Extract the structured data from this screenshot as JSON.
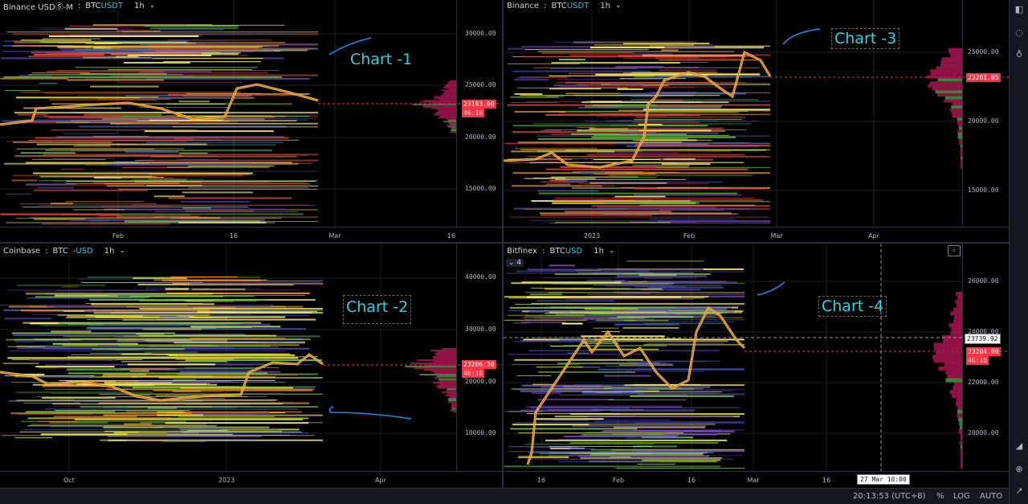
{
  "charts": [
    {
      "id": "tl",
      "exchange": "Binance USDⓈ-M",
      "pair_base": "BTC",
      "pair_quote": "USDT",
      "interval": "1h",
      "price_ticks": [
        "30000.00",
        "25000.00",
        "20000.00",
        "15000.00"
      ],
      "time_labels": [
        "Feb",
        "16",
        "Mar",
        "16"
      ],
      "last_price": "23193.00",
      "countdown": "46:18",
      "annotation": "Chart -1"
    },
    {
      "id": "tr",
      "exchange": "Binance",
      "pair_base": "BTC",
      "pair_quote": "USDT",
      "interval": "1h",
      "price_ticks": [
        "25000.00",
        "20000.00",
        "15000.00"
      ],
      "time_labels": [
        "2023",
        "Feb",
        "Mar",
        "Apr"
      ],
      "last_price": "23201.05",
      "annotation": "Chart -3"
    },
    {
      "id": "bl",
      "exchange": "Coinbase",
      "pair_base": "BTC",
      "pair_quote": "USD",
      "interval": "1h",
      "price_ticks": [
        "40000.00",
        "30000.00",
        "20000.00",
        "10000.00"
      ],
      "time_labels": [
        "Oct",
        "2023",
        "Apr"
      ],
      "last_price": "23206.30",
      "countdown": "46:18",
      "annotation": "Chart -2"
    },
    {
      "id": "br",
      "exchange": "Bitfinex",
      "pair_base": "BTC",
      "pair_quote": "USD",
      "interval": "1h",
      "collapsed_count": "4",
      "price_ticks": [
        "26000.00",
        "24000.00",
        "22000.00",
        "20000.00"
      ],
      "time_labels": [
        "16",
        "Feb",
        "16",
        "Mar",
        "16"
      ],
      "crosshair_price": "23739.92",
      "last_price": "23204.00",
      "countdown": "46:18",
      "crosshair_time": "27 Mar 10:00",
      "annotation": "Chart -4"
    }
  ],
  "bottom_bar": {
    "clock": "20:13:53 (UTC+8)",
    "percent": "%",
    "log": "LOG",
    "auto": "AUTO"
  },
  "right_toolbar": [
    "sidebar-toggle-icon",
    "chat-icon",
    "lightbulb-icon",
    "chart-ruler-icon",
    "globe-icon",
    "arrow-icon"
  ],
  "colors": {
    "background": "#000000",
    "accent_cyan": "#26c6da",
    "annotation": "#2ad5e3",
    "price_red": "#f23645",
    "heat_yellow": "#e8e338",
    "heat_orange": "#f08a24"
  }
}
